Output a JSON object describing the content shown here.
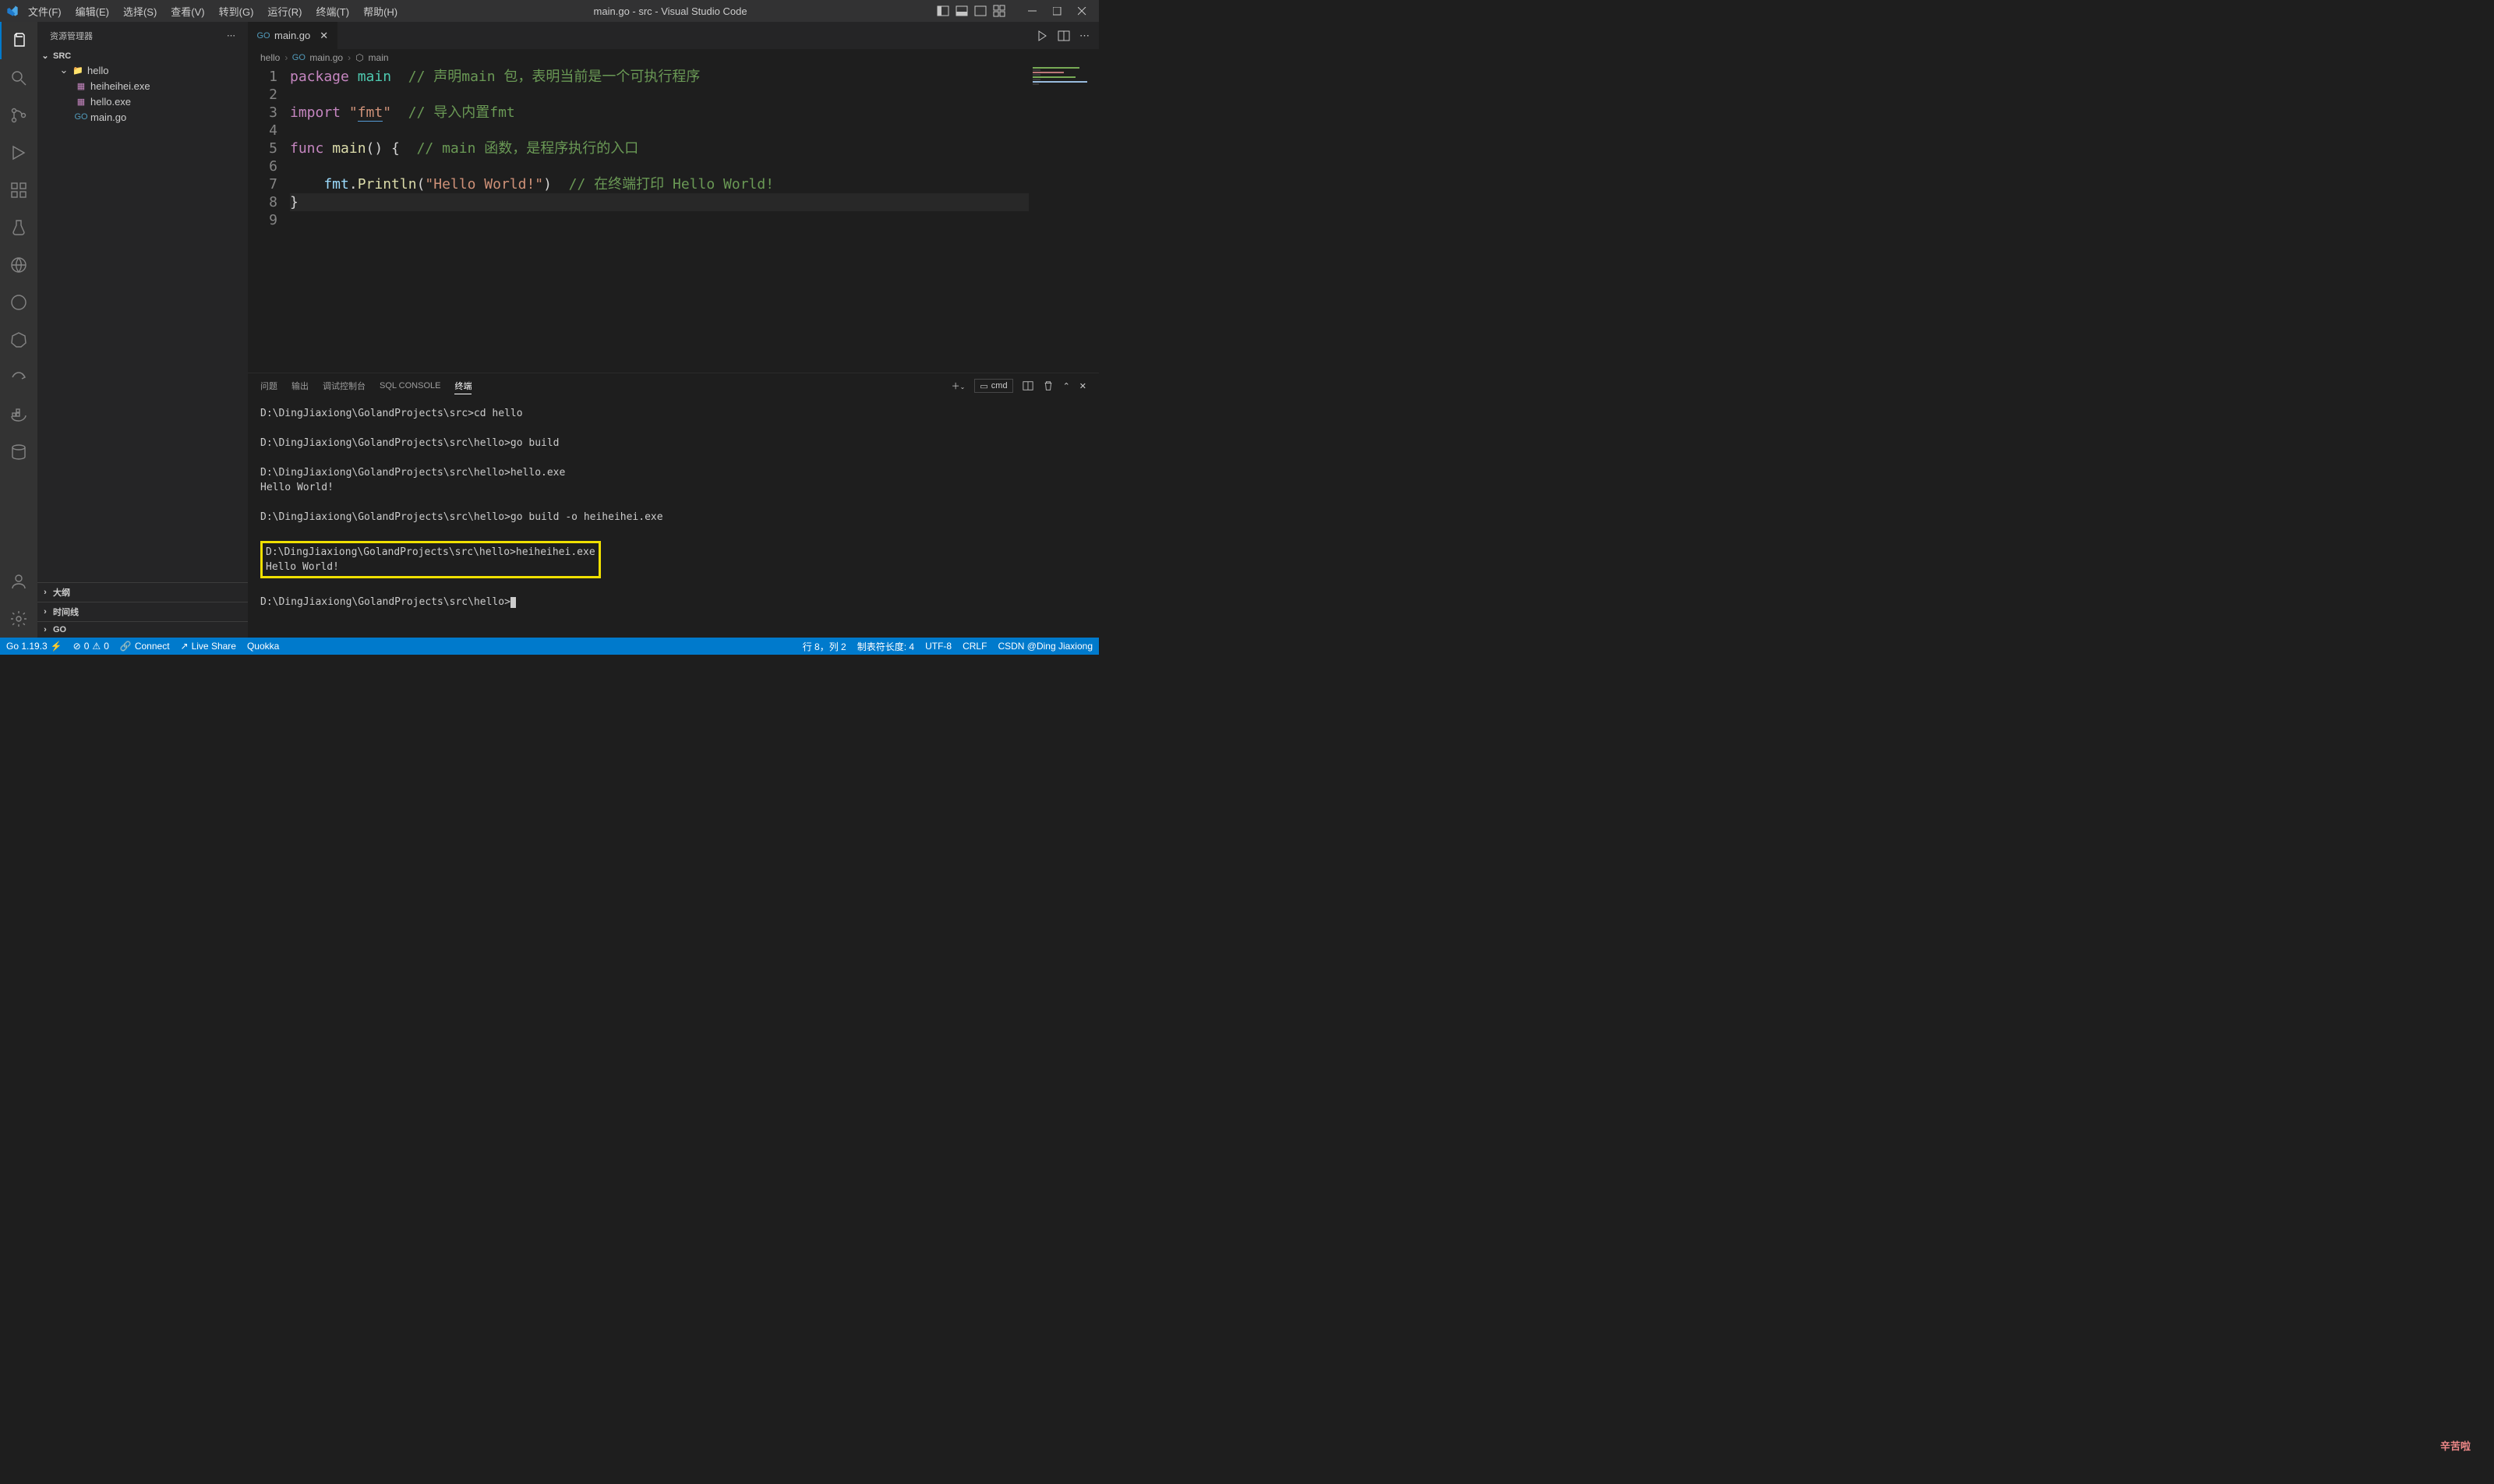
{
  "title": "main.go - src - Visual Studio Code",
  "menu": [
    "文件(F)",
    "编辑(E)",
    "选择(S)",
    "查看(V)",
    "转到(G)",
    "运行(R)",
    "终端(T)",
    "帮助(H)"
  ],
  "sidebar": {
    "title": "资源管理器",
    "root": "SRC",
    "folder": "hello",
    "files": [
      "heiheihei.exe",
      "hello.exe",
      "main.go"
    ],
    "collapsed": [
      "大纲",
      "时间线",
      "GO"
    ]
  },
  "tab": {
    "name": "main.go"
  },
  "breadcrumb": [
    "hello",
    "main.go",
    "main"
  ],
  "code": {
    "lines": [
      {
        "n": 1,
        "segs": [
          [
            "package ",
            "kw"
          ],
          [
            "main",
            "type"
          ],
          [
            "  // 声明main 包，表明当前是一个可执行程序",
            "comment"
          ]
        ]
      },
      {
        "n": 2,
        "segs": []
      },
      {
        "n": 3,
        "segs": [
          [
            "import ",
            "kw"
          ],
          [
            "\"",
            "str"
          ],
          [
            "fmt",
            "str cursor"
          ],
          [
            "\"",
            "str"
          ],
          [
            "  // 导入内置fmt",
            "comment"
          ]
        ]
      },
      {
        "n": 4,
        "segs": []
      },
      {
        "n": 5,
        "segs": [
          [
            "func ",
            "kw"
          ],
          [
            "main",
            "fn"
          ],
          [
            "() { ",
            "punc"
          ],
          [
            " // main 函数，是程序执行的入口",
            "comment"
          ]
        ]
      },
      {
        "n": 6,
        "segs": []
      },
      {
        "n": 7,
        "segs": [
          [
            "    fmt",
            "ident"
          ],
          [
            ".",
            "punc"
          ],
          [
            "Println",
            "fn"
          ],
          [
            "(",
            "punc"
          ],
          [
            "\"Hello World!\"",
            "str"
          ],
          [
            ") ",
            "punc"
          ],
          [
            " // 在终端打印 Hello World!",
            "comment"
          ]
        ]
      },
      {
        "n": 8,
        "segs": [
          [
            "}",
            "punc"
          ]
        ],
        "current": true
      },
      {
        "n": 9,
        "segs": []
      }
    ]
  },
  "panel": {
    "tabs": [
      "问题",
      "输出",
      "调试控制台",
      "SQL CONSOLE",
      "终端"
    ],
    "active": 4,
    "termLabel": "cmd",
    "terminal": [
      "D:\\DingJiaxiong\\GolandProjects\\src>cd hello",
      "",
      "D:\\DingJiaxiong\\GolandProjects\\src\\hello>go build",
      "",
      "D:\\DingJiaxiong\\GolandProjects\\src\\hello>hello.exe",
      "Hello World!",
      "",
      "D:\\DingJiaxiong\\GolandProjects\\src\\hello>go build -o heiheihei.exe",
      ""
    ],
    "highlighted": [
      "D:\\DingJiaxiong\\GolandProjects\\src\\hello>heiheihei.exe",
      "Hello World!"
    ],
    "prompt": "D:\\DingJiaxiong\\GolandProjects\\src\\hello>"
  },
  "status": {
    "go": "Go 1.19.3",
    "errors": "0",
    "warnings": "0",
    "connect": "Connect",
    "liveshare": "Live Share",
    "quokka": "Quokka",
    "ln": "行 8，列 2",
    "tab": "制表符长度: 4",
    "enc": "UTF-8",
    "eol": "CRLF",
    "watermark": "CSDN @Ding Jiaxiong",
    "corner_text": "辛苦啦"
  }
}
